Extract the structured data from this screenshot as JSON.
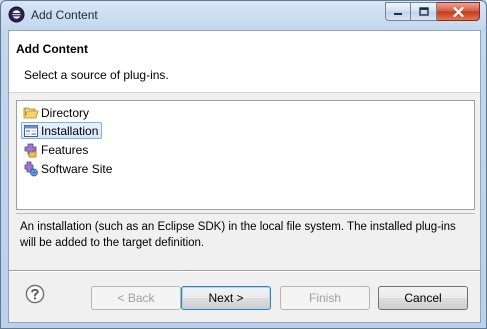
{
  "window": {
    "title": "Add Content",
    "icons": {
      "app": "eclipse-icon",
      "minimize": "minimize-icon",
      "maximize": "maximize-icon",
      "close": "close-icon"
    }
  },
  "header": {
    "title": "Add Content",
    "message": "Select a source of plug-ins."
  },
  "sources": [
    {
      "label": "Directory",
      "icon": "folder-icon",
      "selected": false
    },
    {
      "label": "Installation",
      "icon": "installation-icon",
      "selected": true
    },
    {
      "label": "Features",
      "icon": "features-icon",
      "selected": false
    },
    {
      "label": "Software Site",
      "icon": "software-site-icon",
      "selected": false
    }
  ],
  "description": "An installation (such as an Eclipse SDK) in the local file system. The installed plug-ins will be added to the target definition.",
  "footer": {
    "help_icon": "help-icon",
    "back_label": "< Back",
    "next_label": "Next >",
    "finish_label": "Finish",
    "cancel_label": "Cancel"
  }
}
